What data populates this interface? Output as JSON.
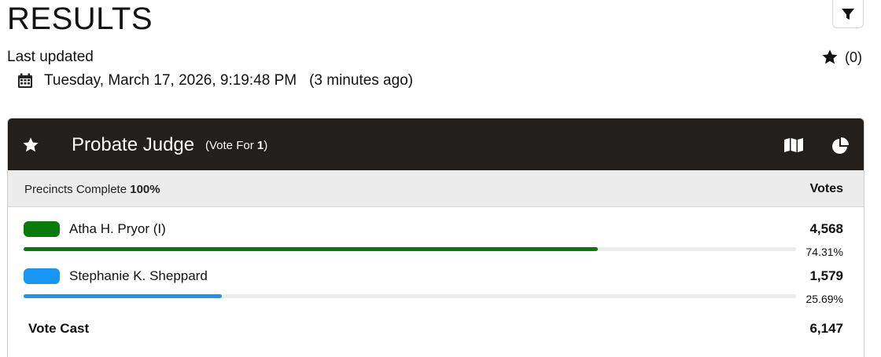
{
  "page": {
    "title": "RESULTS",
    "last_updated_label": "Last updated",
    "timestamp": "Tuesday, March 17, 2026, 9:19:48 PM",
    "relative_time": "(3 minutes ago)",
    "favorites_count": "(0)"
  },
  "icons": {
    "filter": "filter-icon",
    "favorites": "star-icon",
    "calendar": "calendar-icon",
    "contest_favorite": "star-icon",
    "map": "map-icon",
    "chart": "pie-chart-icon"
  },
  "contest": {
    "name": "Probate Judge",
    "vote_for_prefix": "(Vote For ",
    "vote_for_number": "1",
    "vote_for_suffix": ")",
    "precincts_label": "Precincts Complete",
    "precincts_value": "100%",
    "votes_header": "Votes",
    "header_color": "#231f1c",
    "candidates": [
      {
        "name": "Atha H. Pryor (I)",
        "votes": "4,568",
        "percent": "74.31%",
        "share": 74.31,
        "color": "#0a7a0a"
      },
      {
        "name": "Stephanie K. Sheppard",
        "votes": "1,579",
        "percent": "25.69%",
        "share": 25.69,
        "color": "#1795f2"
      }
    ],
    "total_label": "Vote Cast",
    "total_value": "6,147"
  }
}
